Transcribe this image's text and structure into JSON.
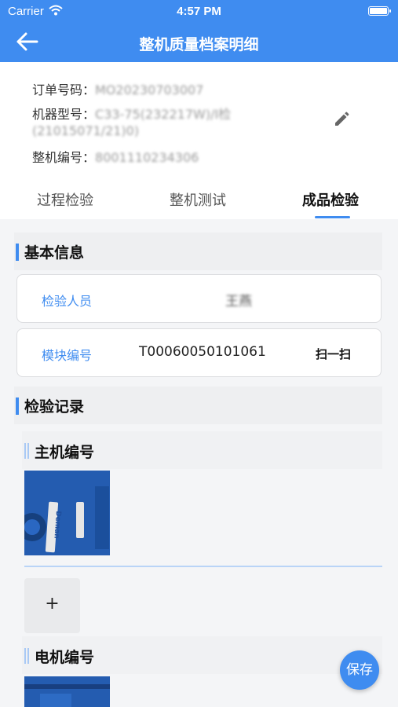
{
  "status_bar": {
    "carrier": "Carrier",
    "time": "4:57 PM"
  },
  "nav": {
    "title": "整机质量档案明细"
  },
  "order": {
    "order_label": "订单号码：",
    "order_value": "MO20230703007",
    "model_label": "机器型号：",
    "model_value_line1": "C33-75(232217W)/I检",
    "model_value_line2": "(21015071/21)0)",
    "serial_label": "整机编号：",
    "serial_value": "8001110234306"
  },
  "tabs": [
    {
      "label": "过程检验"
    },
    {
      "label": "整机测试"
    },
    {
      "label": "成品检验"
    }
  ],
  "active_tab": 2,
  "basic_info": {
    "title": "基本信息",
    "inspector_label": "检验人员",
    "inspector_value": "王燕",
    "module_label": "模块编号",
    "module_value": "T00060050101061",
    "scan_label": "扫一扫"
  },
  "records": {
    "title": "检验记录",
    "host_title": "主机编号",
    "add_symbol": "+",
    "motor_title": "电机编号",
    "nameplate_text": "Deman"
  },
  "save_label": "保存",
  "colors": {
    "primary": "#3f8cf0",
    "background": "#f4f5f7"
  }
}
